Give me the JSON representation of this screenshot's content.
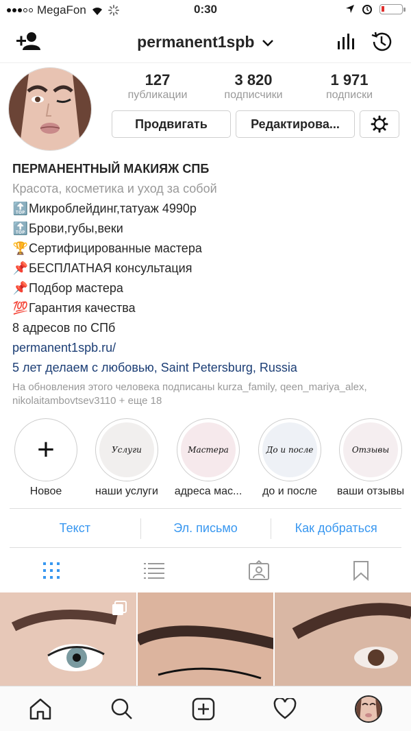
{
  "status_bar": {
    "carrier": "MegaFon",
    "time": "0:30"
  },
  "header": {
    "username": "permanent1spb",
    "icons": [
      "add-user-icon",
      "chevron-down-icon",
      "insights-icon",
      "archive-icon"
    ]
  },
  "profile": {
    "stats": [
      {
        "value": "127",
        "label": "публикации"
      },
      {
        "value": "3 820",
        "label": "подписчики"
      },
      {
        "value": "1 971",
        "label": "подписки"
      }
    ],
    "promote_label": "Продвигать",
    "edit_label": "Редактирова...",
    "settings_icon": "gear-icon"
  },
  "bio": {
    "name": "ПЕРМАНЕНТНЫЙ МАКИЯЖ СПБ",
    "category": "Красота, косметика и уход за собой",
    "lines": [
      {
        "emoji": "🔝",
        "text": "Микроблейдинг,татуаж 4990р"
      },
      {
        "emoji": "🔝",
        "text": "Брови,губы,веки"
      },
      {
        "emoji": "🏆",
        "text": "Сертифицированные мастера"
      },
      {
        "emoji": "📌",
        "text": "БЕСПЛАТНАЯ консультация"
      },
      {
        "emoji": "📌",
        "text": "Подбор мастера"
      },
      {
        "emoji": "💯",
        "text": "Гарантия качества"
      }
    ],
    "addresses": "8 адресов по СПб",
    "website": "permanent1spb.ru/",
    "location": "5 лет делаем с любовью, Saint Petersburg, Russia",
    "followed_by": "На обновления этого человека подписаны kurza_family, qeen_mariya_alex, nikolaitambovtsev3110 + еще 18"
  },
  "highlights": [
    {
      "label": "Новое",
      "cover": "+"
    },
    {
      "label": "наши услуги",
      "cover": "Услуги"
    },
    {
      "label": "адреса мас...",
      "cover": "Мастера"
    },
    {
      "label": "до и после",
      "cover": "До и после"
    },
    {
      "label": "ваши отзывы",
      "cover": "Отзывы"
    }
  ],
  "contacts": {
    "text_label": "Текст",
    "email_label": "Эл. письмо",
    "directions_label": "Как добраться"
  },
  "profile_tabs": [
    "grid-icon",
    "list-icon",
    "tagged-icon",
    "saved-icon"
  ],
  "tab_bar": [
    "home-icon",
    "search-icon",
    "new-post-icon",
    "activity-icon",
    "profile-avatar"
  ],
  "colors": {
    "link": "#3897f0",
    "website": "#1c3e75",
    "secondary": "#999999",
    "active_tab": "#3897f0"
  }
}
